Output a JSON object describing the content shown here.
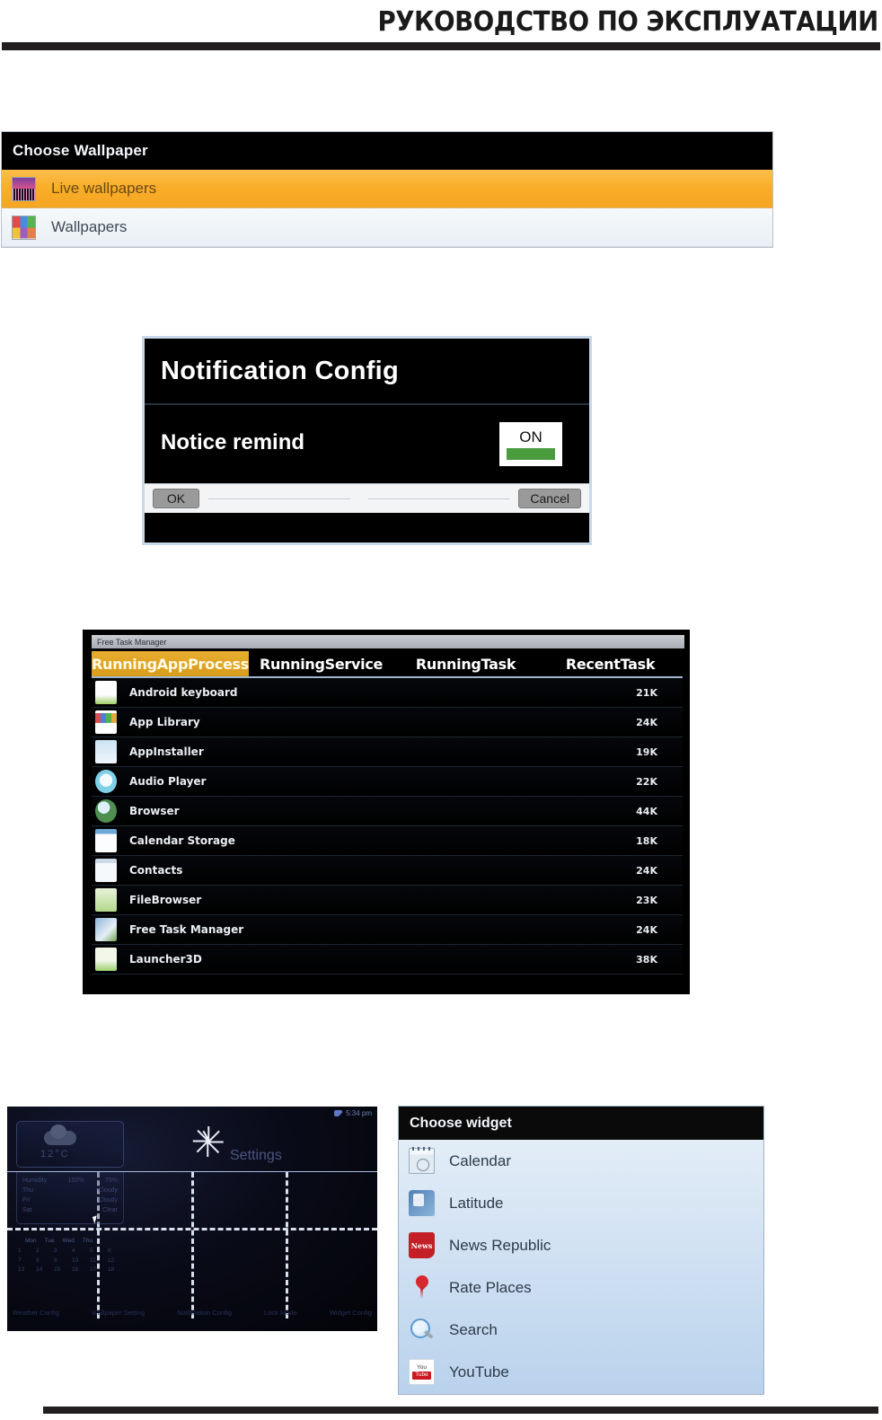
{
  "header": {
    "title": "РУКОВОДСТВО ПО ЭКСПЛУАТАЦИИ"
  },
  "wallpaper_dialog": {
    "title": "Choose Wallpaper",
    "items": [
      {
        "label": "Live wallpapers",
        "icon": "live-wallpaper-icon",
        "selected": true
      },
      {
        "label": "Wallpapers",
        "icon": "wallpapers-icon",
        "selected": false
      }
    ]
  },
  "notification_dialog": {
    "title": "Notification Config",
    "row_label": "Notice remind",
    "toggle_state": "ON",
    "toggle_color": "#4b9b3f",
    "ok_label": "OK",
    "cancel_label": "Cancel"
  },
  "task_manager": {
    "window_title": "Free Task Manager",
    "tabs": [
      {
        "label": "RunningAppProcess",
        "active": true
      },
      {
        "label": "RunningService",
        "active": false
      },
      {
        "label": "RunningTask",
        "active": false
      },
      {
        "label": "RecentTask",
        "active": false
      }
    ],
    "active_tab_color": "#d79c1c",
    "rows": [
      {
        "name": "Android keyboard",
        "size": "21K",
        "icon": "android-keyboard-icon"
      },
      {
        "name": "App Library",
        "size": "24K",
        "icon": "app-library-icon"
      },
      {
        "name": "AppInstaller",
        "size": "19K",
        "icon": "app-installer-icon"
      },
      {
        "name": "Audio Player",
        "size": "22K",
        "icon": "audio-player-icon"
      },
      {
        "name": "Browser",
        "size": "44K",
        "icon": "browser-icon"
      },
      {
        "name": "Calendar Storage",
        "size": "18K",
        "icon": "calendar-storage-icon"
      },
      {
        "name": "Contacts",
        "size": "24K",
        "icon": "contacts-icon"
      },
      {
        "name": "FileBrowser",
        "size": "23K",
        "icon": "file-browser-icon"
      },
      {
        "name": "Free Task Manager",
        "size": "24K",
        "icon": "free-task-manager-icon"
      },
      {
        "name": "Launcher3D",
        "size": "38K",
        "icon": "launcher3d-icon"
      }
    ]
  },
  "home_screen": {
    "status_time": "5:34 pm",
    "settings_label": "Settings",
    "weather_temp": "12°C",
    "weather_rows": [
      {
        "left": "Humidity",
        "mid": "100%",
        "right": "79%"
      },
      {
        "left": "Thu",
        "mid": "Cloudy",
        "right": ""
      },
      {
        "left": "Fri",
        "mid": "Cloudy",
        "right": ""
      },
      {
        "left": "Sat",
        "mid": "Clear",
        "right": ""
      }
    ],
    "calendar_days": [
      "Mon",
      "Tue",
      "Wed",
      "Thu"
    ],
    "calendar_numbers": [
      "1",
      "2",
      "3",
      "4",
      "5",
      "6",
      "7",
      "8",
      "9",
      "10",
      "11",
      "12",
      "13",
      "14",
      "15",
      "16",
      "17",
      "18"
    ],
    "bottom_labels": [
      "Weather Config",
      "Wallpaper Setting",
      "Notification Config",
      "Lock Mode",
      "Widget Config"
    ]
  },
  "widget_dialog": {
    "title": "Choose widget",
    "items": [
      {
        "label": "Calendar",
        "icon": "calendar-icon"
      },
      {
        "label": "Latitude",
        "icon": "latitude-icon"
      },
      {
        "label": "News Republic",
        "icon": "news-republic-icon",
        "badge": "News"
      },
      {
        "label": "Rate Places",
        "icon": "map-pin-icon"
      },
      {
        "label": "Search",
        "icon": "search-icon"
      },
      {
        "label": "YouTube",
        "icon": "youtube-icon",
        "badge_top": "You",
        "badge_bottom": "Tube"
      }
    ]
  }
}
